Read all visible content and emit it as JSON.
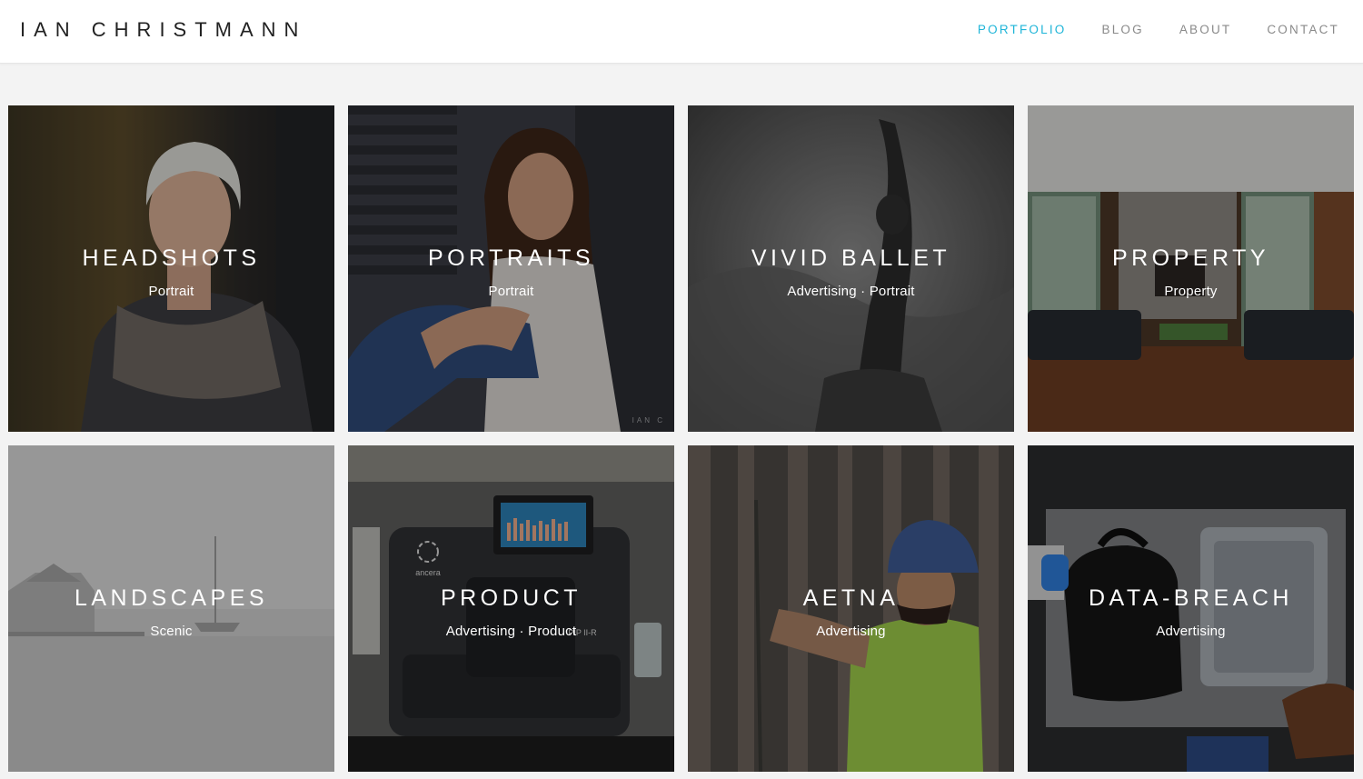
{
  "header": {
    "logo": "IAN CHRISTMANN",
    "nav": [
      {
        "label": "PORTFOLIO",
        "active": true
      },
      {
        "label": "BLOG",
        "active": false
      },
      {
        "label": "ABOUT",
        "active": false
      },
      {
        "label": "CONTACT",
        "active": false
      }
    ]
  },
  "accent_color": "#1fb5d8",
  "portfolio": [
    {
      "title": "HEADSHOTS",
      "category": "Portrait"
    },
    {
      "title": "PORTRAITS",
      "category": "Portrait"
    },
    {
      "title": "VIVID BALLET",
      "category": "Advertising · Portrait"
    },
    {
      "title": "PROPERTY",
      "category": "Property"
    },
    {
      "title": "LANDSCAPES",
      "category": "Scenic"
    },
    {
      "title": "PRODUCT",
      "category": "Advertising · Product"
    },
    {
      "title": "AETNA",
      "category": "Advertising"
    },
    {
      "title": "DATA-BREACH",
      "category": "Advertising"
    }
  ],
  "watermark": "IAN C",
  "screen_text": {
    "device_brand": "ancera",
    "device_label": "PIP II-R"
  }
}
